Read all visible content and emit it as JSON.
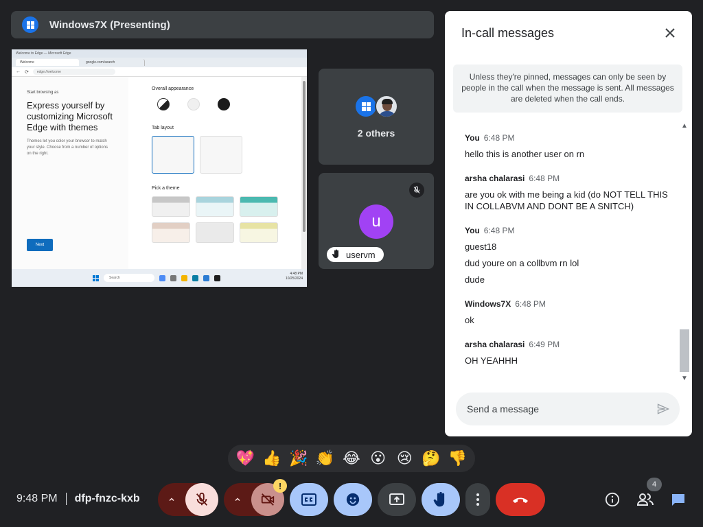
{
  "presenting": {
    "title": "Windows7X (Presenting)"
  },
  "shared_screen": {
    "window_title": "Welcome to Edge — Microsoft Edge",
    "tabs": [
      "Welcome",
      "google.com/search"
    ],
    "address": "edge://welcome",
    "left": {
      "kicker": "Start browsing as",
      "headline": "Express yourself by customizing Microsoft Edge with themes",
      "description": "Themes let you color your browser to match your style. Choose from a number of options on the right.",
      "next_label": "Next"
    },
    "right": {
      "appearance_heading": "Overall appearance",
      "tab_layout_heading": "Tab layout",
      "theme_heading": "Pick a theme"
    },
    "taskbar": {
      "search_placeholder": "Search",
      "time": "4:48 PM",
      "date": "10/25/2024"
    }
  },
  "tiles": {
    "others": {
      "label": "2 others"
    },
    "user": {
      "initial": "u",
      "name": "uservm"
    }
  },
  "chat": {
    "title": "In-call messages",
    "notice": "Unless they're pinned, messages can only be seen by people in the call when the message is sent. All messages are deleted when the call ends.",
    "groups": [
      {
        "sender": "You",
        "time": "6:48 PM",
        "lines": [
          "hello this is another user on rn"
        ]
      },
      {
        "sender": "arsha chalarasi",
        "time": "6:48 PM",
        "lines": [
          "are you ok with me being a kid (do NOT TELL THIS IN COLLABVM AND DONT BE A SNITCH)"
        ]
      },
      {
        "sender": "You",
        "time": "6:48 PM",
        "lines": [
          "guest18",
          "dud youre on a collbvm rn lol",
          "dude"
        ]
      },
      {
        "sender": "Windows7X",
        "time": "6:48 PM",
        "lines": [
          "ok"
        ]
      },
      {
        "sender": "arsha chalarasi",
        "time": "6:49 PM",
        "lines": [
          "OH YEAHHH"
        ]
      }
    ],
    "input_placeholder": "Send a message"
  },
  "reactions": [
    "💖",
    "👍",
    "🎉",
    "👏",
    "😂",
    "😮",
    "😢",
    "🤔",
    "👎"
  ],
  "meeting": {
    "time": "9:48 PM",
    "code": "dfp-fnzc-kxb"
  },
  "controls": {
    "camera_warning": "!",
    "people_count": "4"
  },
  "colors": {
    "background": "#202124",
    "end_call": "#d93025",
    "active_control": "#a8c7fa",
    "muted_control": "#f9dedc",
    "avatar_user": "#a142f4",
    "accent": "#1a73e8"
  }
}
